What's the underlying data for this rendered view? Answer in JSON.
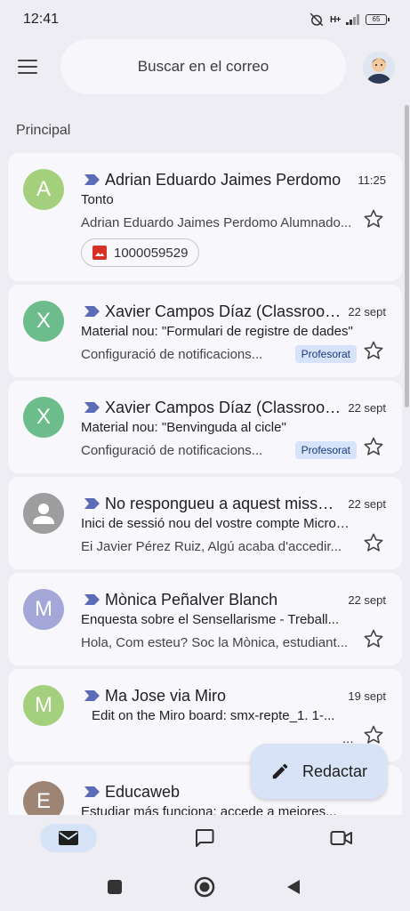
{
  "status_bar": {
    "time": "12:41",
    "network": "H+",
    "battery": "65"
  },
  "header": {
    "search_placeholder": "Buscar en el correo",
    "menu_icon": "hamburger-menu-icon",
    "account_avatar": "profile-avatar"
  },
  "section": {
    "label": "Principal"
  },
  "emails": [
    {
      "initial": "A",
      "avatar_color": "#a4d07d",
      "sender": "Adrian Eduardo Jaimes Perdomo",
      "date": "11:25",
      "subject": "Tonto",
      "snippet": "Adrian Eduardo Jaimes Perdomo Alumnado...",
      "attachment": "1000059529"
    },
    {
      "initial": "X",
      "avatar_color": "#6cbd8b",
      "sender": "Xavier Campos Díaz (Classroom)",
      "date": "22 sept",
      "subject": "Material nou: \"Formulari de registre de dades\"",
      "snippet": "Configuració de notificacions...",
      "label": "Profesorat"
    },
    {
      "initial": "X",
      "avatar_color": "#6cbd8b",
      "sender": "Xavier Campos Díaz (Classroom)",
      "date": "22 sept",
      "subject": "Material nou: \"Benvinguda al cicle\"",
      "snippet": "Configuració de notificacions...",
      "label": "Profesorat"
    },
    {
      "initial": "",
      "avatar_color": "#9e9e9e",
      "sender": "No respongueu a aquest missatge",
      "date": "22 sept",
      "subject": "Inici de sessió nou del vostre compte Microsoft",
      "snippet": "Ei Javier Pérez Ruiz, Algú acaba d'accedir..."
    },
    {
      "initial": "M",
      "avatar_color": "#a4a8d8",
      "sender": "Mònica Peñalver Blanch",
      "date": "22 sept",
      "subject": "Enquesta sobre el Sensellarisme - Treball...",
      "snippet": "Hola, Com esteu? Soc la Mònica, estudiant..."
    },
    {
      "initial": "M",
      "avatar_color": "#a4d07d",
      "sender": "Ma Jose via Miro",
      "date": "19 sept",
      "subject": "Edit on the Miro board: smx-repte_1. 1-...",
      "snippet": "..."
    },
    {
      "initial": "E",
      "avatar_color": "#9e8475",
      "sender": "Educaweb",
      "date": "",
      "subject": "Estudiar más funciona: accede a mejores...",
      "snippet": ""
    }
  ],
  "fab": {
    "label": "Redactar"
  },
  "colors": {
    "background": "#eeedf3",
    "card": "#f8f7fb",
    "accent": "#5b6bb8",
    "label_chip": "#d6e3fb"
  }
}
